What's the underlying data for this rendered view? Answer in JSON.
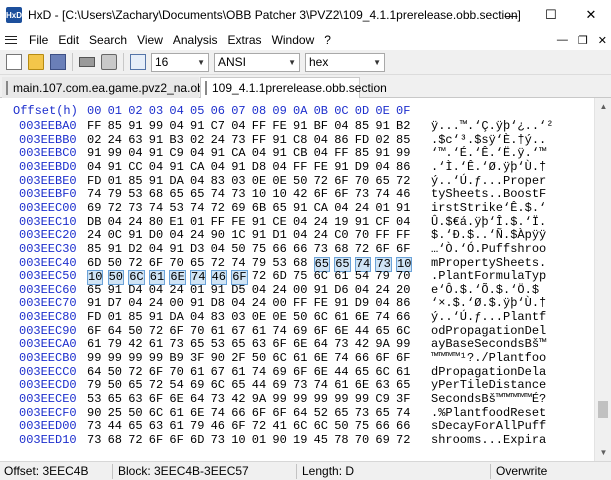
{
  "titlebar": {
    "app_icon": "HxD",
    "title": "HxD - [C:\\Users\\Zachary\\Documents\\OBB Patcher 3\\PVZ2\\109_4.1.1prerelease.obb.section]",
    "icons": [
      "minimize-icon",
      "maximize-icon",
      "close-icon"
    ],
    "minimize": "—",
    "maximize": "☐",
    "close": "✕"
  },
  "menubar": {
    "items": [
      "File",
      "Edit",
      "Search",
      "View",
      "Analysis",
      "Extras",
      "Window",
      "?"
    ],
    "mdi": {
      "minimize": "—",
      "restore": "❐",
      "close": "✕"
    }
  },
  "toolbar": {
    "bytes_per_row": "16",
    "charset": "ANSI",
    "offset_base": "hex",
    "icons": [
      "new-file-icon",
      "open-folder-icon",
      "save-icon",
      "open-ram-icon",
      "open-disk-icon",
      "columns-icon"
    ]
  },
  "tabs": [
    {
      "label": "main.107.com.ea.game.pvz2_na.obb"
    },
    {
      "label": "109_4.1.1prerelease.obb.section"
    }
  ],
  "editor": {
    "offset_header": "Offset(h)",
    "columns": [
      "00",
      "01",
      "02",
      "03",
      "04",
      "05",
      "06",
      "07",
      "08",
      "09",
      "0A",
      "0B",
      "0C",
      "0D",
      "0E",
      "0F"
    ],
    "rows": [
      {
        "offset": "003EEBA0",
        "hex": [
          "FF",
          "85",
          "91",
          "99",
          "04",
          "91",
          "C7",
          "04",
          "FF",
          "FE",
          "91",
          "BF",
          "04",
          "85",
          "91",
          "B2"
        ],
        "ascii": "ÿ...™.‘Ç.ÿþ‘¿..‘²"
      },
      {
        "offset": "003EEBB0",
        "hex": [
          "02",
          "24",
          "63",
          "91",
          "B3",
          "02",
          "24",
          "73",
          "FF",
          "91",
          "C8",
          "04",
          "86",
          "FD",
          "02",
          "85"
        ],
        "ascii": ".$c‘³.$sÿ‘È.†ý.."
      },
      {
        "offset": "003EEBC0",
        "hex": [
          "91",
          "99",
          "04",
          "91",
          "C9",
          "04",
          "91",
          "CA",
          "04",
          "91",
          "CB",
          "04",
          "FF",
          "85",
          "91",
          "99"
        ],
        "ascii": "‘™.‘É.‘Ê.‘Ë.ÿ.‘™"
      },
      {
        "offset": "003EEBD0",
        "hex": [
          "04",
          "91",
          "CC",
          "04",
          "91",
          "CA",
          "04",
          "91",
          "D8",
          "04",
          "FF",
          "FE",
          "91",
          "D9",
          "04",
          "86"
        ],
        "ascii": ".‘Ì.‘Ê.‘Ø.ÿþ‘Ù.†"
      },
      {
        "offset": "003EEBE0",
        "hex": [
          "FD",
          "01",
          "85",
          "91",
          "DA",
          "04",
          "83",
          "03",
          "0E",
          "0E",
          "50",
          "72",
          "6F",
          "70",
          "65",
          "72"
        ],
        "ascii": "ý..‘Ú.ƒ...Proper"
      },
      {
        "offset": "003EEBF0",
        "hex": [
          "74",
          "79",
          "53",
          "68",
          "65",
          "65",
          "74",
          "73",
          "10",
          "10",
          "42",
          "6F",
          "6F",
          "73",
          "74",
          "46"
        ],
        "ascii": "tySheets..BoostF"
      },
      {
        "offset": "003EEC00",
        "hex": [
          "69",
          "72",
          "73",
          "74",
          "53",
          "74",
          "72",
          "69",
          "6B",
          "65",
          "91",
          "CA",
          "04",
          "24",
          "01",
          "91"
        ],
        "ascii": "irstStrike‘Ê.$.‘"
      },
      {
        "offset": "003EEC10",
        "hex": [
          "DB",
          "04",
          "24",
          "80",
          "E1",
          "01",
          "FF",
          "FE",
          "91",
          "CE",
          "04",
          "24",
          "19",
          "91",
          "CF",
          "04"
        ],
        "ascii": "Û.$€á.ÿþ‘Î.$.‘Ï."
      },
      {
        "offset": "003EEC20",
        "hex": [
          "24",
          "0C",
          "91",
          "D0",
          "04",
          "24",
          "90",
          "1C",
          "91",
          "D1",
          "04",
          "24",
          "C0",
          "70",
          "FF",
          "FF"
        ],
        "ascii": "$.‘Ð.$..‘Ñ.$Àpÿÿ"
      },
      {
        "offset": "003EEC30",
        "hex": [
          "85",
          "91",
          "D2",
          "04",
          "91",
          "D3",
          "04",
          "50",
          "75",
          "66",
          "66",
          "73",
          "68",
          "72",
          "6F",
          "6F"
        ],
        "ascii": "…‘Ò.‘Ó.Puffshroo"
      },
      {
        "offset": "003EEC40",
        "hex": [
          "6D",
          "50",
          "72",
          "6F",
          "70",
          "65",
          "72",
          "74",
          "79",
          "53",
          "68",
          "65",
          "65",
          "74",
          "73",
          "10"
        ],
        "ascii": "mPropertySheets."
      },
      {
        "offset": "003EEC50",
        "hex": [
          "10",
          "50",
          "6C",
          "61",
          "6E",
          "74",
          "46",
          "6F",
          "72",
          "6D",
          "75",
          "6C",
          "61",
          "54",
          "79",
          "70"
        ],
        "ascii": ".PlantFormulaTyp"
      },
      {
        "offset": "003EEC60",
        "hex": [
          "65",
          "91",
          "D4",
          "04",
          "24",
          "01",
          "91",
          "D5",
          "04",
          "24",
          "00",
          "91",
          "D6",
          "04",
          "24",
          "20"
        ],
        "ascii": "e‘Ô.$.‘Õ.$.‘Ö.$ "
      },
      {
        "offset": "003EEC70",
        "hex": [
          "91",
          "D7",
          "04",
          "24",
          "00",
          "91",
          "D8",
          "04",
          "24",
          "00",
          "FF",
          "FE",
          "91",
          "D9",
          "04",
          "86"
        ],
        "ascii": "‘×.$.‘Ø.$.ÿþ‘Ù.†"
      },
      {
        "offset": "003EEC80",
        "hex": [
          "FD",
          "01",
          "85",
          "91",
          "DA",
          "04",
          "83",
          "03",
          "0E",
          "0E",
          "50",
          "6C",
          "61",
          "6E",
          "74",
          "66"
        ],
        "ascii": "ý..‘Ú.ƒ...Plantf"
      },
      {
        "offset": "003EEC90",
        "hex": [
          "6F",
          "64",
          "50",
          "72",
          "6F",
          "70",
          "61",
          "67",
          "61",
          "74",
          "69",
          "6F",
          "6E",
          "44",
          "65",
          "6C"
        ],
        "ascii": "odPropagationDel"
      },
      {
        "offset": "003EECA0",
        "hex": [
          "61",
          "79",
          "42",
          "61",
          "73",
          "65",
          "53",
          "65",
          "63",
          "6F",
          "6E",
          "64",
          "73",
          "42",
          "9A",
          "99"
        ],
        "ascii": "ayBaseSecondsBš™"
      },
      {
        "offset": "003EECB0",
        "hex": [
          "99",
          "99",
          "99",
          "99",
          "B9",
          "3F",
          "90",
          "2F",
          "50",
          "6C",
          "61",
          "6E",
          "74",
          "66",
          "6F",
          "6F"
        ],
        "ascii": "™™™™¹?./Plantfoo"
      },
      {
        "offset": "003EECC0",
        "hex": [
          "64",
          "50",
          "72",
          "6F",
          "70",
          "61",
          "67",
          "61",
          "74",
          "69",
          "6F",
          "6E",
          "44",
          "65",
          "6C",
          "61"
        ],
        "ascii": "dPropagationDela"
      },
      {
        "offset": "003EECD0",
        "hex": [
          "79",
          "50",
          "65",
          "72",
          "54",
          "69",
          "6C",
          "65",
          "44",
          "69",
          "73",
          "74",
          "61",
          "6E",
          "63",
          "65"
        ],
        "ascii": "yPerTileDistance"
      },
      {
        "offset": "003EECE0",
        "hex": [
          "53",
          "65",
          "63",
          "6F",
          "6E",
          "64",
          "73",
          "42",
          "9A",
          "99",
          "99",
          "99",
          "99",
          "99",
          "C9",
          "3F"
        ],
        "ascii": "SecondsBš™™™™™É?"
      },
      {
        "offset": "003EECF0",
        "hex": [
          "90",
          "25",
          "50",
          "6C",
          "61",
          "6E",
          "74",
          "66",
          "6F",
          "6F",
          "64",
          "52",
          "65",
          "73",
          "65",
          "74"
        ],
        "ascii": ".%PlantfoodReset"
      },
      {
        "offset": "003EED00",
        "hex": [
          "73",
          "44",
          "65",
          "63",
          "61",
          "79",
          "46",
          "6F",
          "72",
          "41",
          "6C",
          "6C",
          "50",
          "75",
          "66",
          "66"
        ],
        "ascii": "sDecayForAllPuff"
      },
      {
        "offset": "003EED10",
        "hex": [
          "73",
          "68",
          "72",
          "6F",
          "6F",
          "6D",
          "73",
          "10",
          "01",
          "90",
          "19",
          "45",
          "78",
          "70",
          "69",
          "72"
        ],
        "ascii": "shrooms...Expira"
      }
    ]
  },
  "status": {
    "offset": "Offset: 3EEC4B",
    "block": "Block: 3EEC4B-3EEC57",
    "length": "Length: D",
    "mode": "Overwrite"
  }
}
